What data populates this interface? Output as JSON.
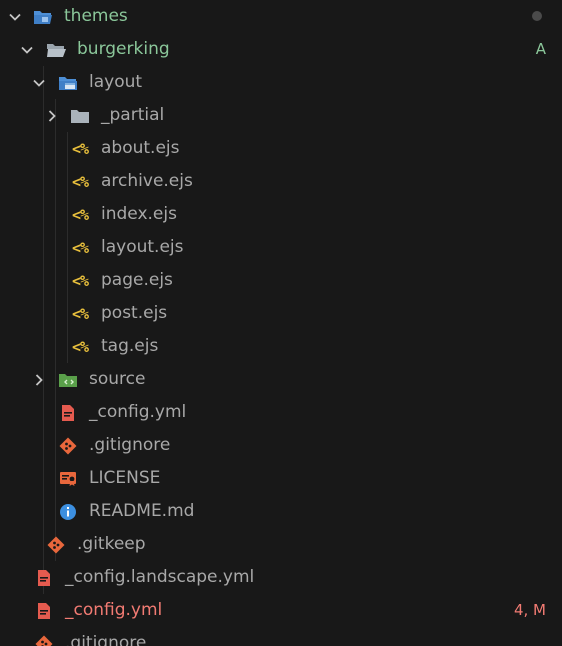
{
  "explorer": {
    "rows": [
      {
        "label": "themes",
        "badge": "",
        "color": "green",
        "icon": "folder-open-blue-icon",
        "chevron": "chevron-down-icon"
      },
      {
        "label": "burgerking",
        "badge": "A",
        "color": "green",
        "icon": "folder-open-gray-icon",
        "chevron": "chevron-down-icon"
      },
      {
        "label": "layout",
        "badge": "",
        "color": "gray",
        "icon": "folder-open-layout-icon",
        "chevron": "chevron-down-icon"
      },
      {
        "label": "_partial",
        "badge": "",
        "color": "gray",
        "icon": "folder-closed-icon",
        "chevron": "chevron-right-icon"
      },
      {
        "label": "about.ejs",
        "badge": "",
        "color": "gray",
        "icon": "ejs-file-icon"
      },
      {
        "label": "archive.ejs",
        "badge": "",
        "color": "gray",
        "icon": "ejs-file-icon"
      },
      {
        "label": "index.ejs",
        "badge": "",
        "color": "gray",
        "icon": "ejs-file-icon"
      },
      {
        "label": "layout.ejs",
        "badge": "",
        "color": "gray",
        "icon": "ejs-file-icon"
      },
      {
        "label": "page.ejs",
        "badge": "",
        "color": "gray",
        "icon": "ejs-file-icon"
      },
      {
        "label": "post.ejs",
        "badge": "",
        "color": "gray",
        "icon": "ejs-file-icon"
      },
      {
        "label": "tag.ejs",
        "badge": "",
        "color": "gray",
        "icon": "ejs-file-icon"
      },
      {
        "label": "source",
        "badge": "",
        "color": "gray",
        "icon": "folder-source-icon",
        "chevron": "chevron-right-icon"
      },
      {
        "label": "_config.yml",
        "badge": "",
        "color": "gray",
        "icon": "yaml-file-icon"
      },
      {
        "label": ".gitignore",
        "badge": "",
        "color": "gray",
        "icon": "git-file-icon"
      },
      {
        "label": "LICENSE",
        "badge": "",
        "color": "gray",
        "icon": "license-file-icon"
      },
      {
        "label": "README.md",
        "badge": "",
        "color": "gray",
        "icon": "info-file-icon"
      },
      {
        "label": ".gitkeep",
        "badge": "",
        "color": "gray",
        "icon": "git-file-icon"
      },
      {
        "label": "_config.landscape.yml",
        "badge": "",
        "color": "gray",
        "icon": "yaml-file-icon"
      },
      {
        "label": "_config.yml",
        "badge": "4, M",
        "color": "red",
        "icon": "yaml-file-icon"
      },
      {
        "label": ".gitignore",
        "badge": "",
        "color": "gray",
        "icon": "git-file-icon"
      }
    ],
    "ejs_glyph": "<%",
    "colors": {
      "background": "#181818",
      "text": "#cccccc",
      "added_green": "#8bc79a",
      "modified_red": "#f27b73",
      "ejs_yellow": "#e8bf3c",
      "folder_blue": "#4d8fd6",
      "yaml_red": "#e55b4f",
      "git_orange": "#e8673c",
      "source_green": "#5aa04a",
      "info_blue": "#3c8fe0"
    }
  }
}
